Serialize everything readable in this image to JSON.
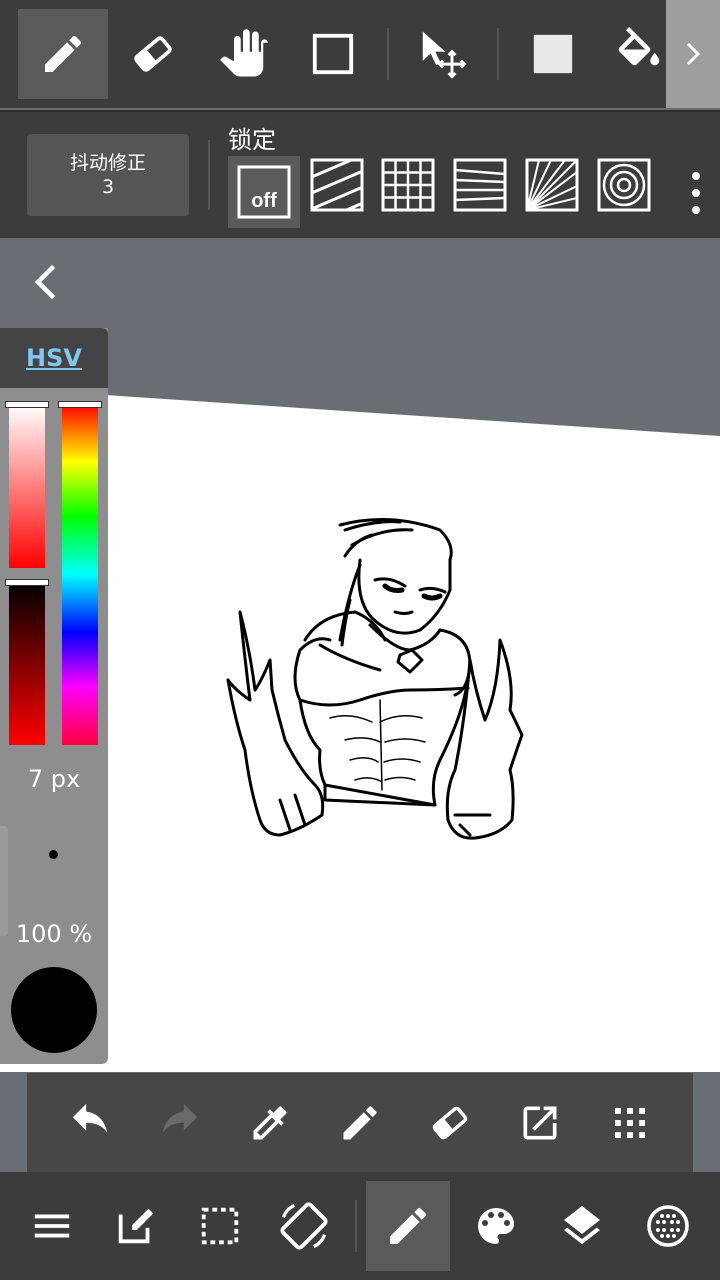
{
  "top_toolbar": {
    "tools": [
      {
        "name": "pen-icon",
        "active": true
      },
      {
        "name": "eraser-icon",
        "active": false
      },
      {
        "name": "hand-icon",
        "active": false
      },
      {
        "name": "rectangle-icon",
        "active": false
      },
      {
        "name": "move-select-icon",
        "active": false
      },
      {
        "name": "filled-square-icon",
        "active": false
      },
      {
        "name": "bucket-icon",
        "active": false
      }
    ],
    "scroll_icon": "chevron-right-icon"
  },
  "stabilizer": {
    "label": "抖动修正",
    "value": "3"
  },
  "lock": {
    "label": "锁定",
    "off_label": "off",
    "options": [
      "off",
      "parallel-lines",
      "grid",
      "perspective-lines",
      "radial-lines",
      "concentric-circles"
    ]
  },
  "color_panel": {
    "mode_label": "HSV",
    "brush_size": "7 px",
    "opacity": "100 %",
    "current_color": "#000000",
    "saturation_handle_fraction": 0,
    "value_handle_fraction": 0,
    "hue_handle_fraction": 0
  },
  "action_bar": {
    "buttons": [
      "undo-icon",
      "redo-icon",
      "eyedropper-icon",
      "pen-icon",
      "eraser-icon",
      "export-icon",
      "grid-dots-icon"
    ]
  },
  "nav_bar": {
    "buttons": [
      "menu-icon",
      "edit-icon",
      "selection-icon",
      "rotate-screen-icon",
      "brush-icon",
      "palette-icon",
      "layers-icon",
      "material-icon"
    ],
    "active": "brush-icon"
  },
  "colors": {
    "toolbar_bg": "#3c3c3c",
    "active_bg": "#5a5a5a",
    "canvas_bg": "#ffffff",
    "backdrop": "#696e74",
    "hsv_accent": "#7ec8f0"
  }
}
